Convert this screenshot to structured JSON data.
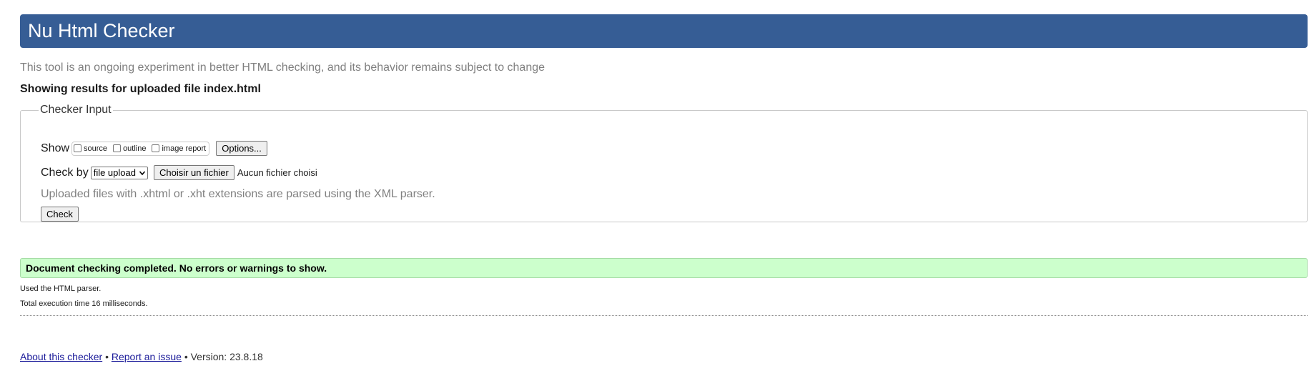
{
  "header": {
    "title": "Nu Html Checker",
    "background_color": "#365d95"
  },
  "tagline": "This tool is an ongoing experiment in better HTML checking, and its behavior remains subject to change",
  "results_for": "Showing results for uploaded file index.html",
  "checker_input": {
    "legend": "Checker Input",
    "show_label": "Show",
    "show_options": [
      {
        "label": "source",
        "checked": false
      },
      {
        "label": "outline",
        "checked": false
      },
      {
        "label": "image report",
        "checked": false
      }
    ],
    "options_button": "Options...",
    "check_by_label": "Check by",
    "check_by_selected": "file upload",
    "choose_file_button": "Choisir un fichier",
    "no_file_text": "Aucun fichier choisi",
    "parser_note": "Uploaded files with .xhtml or .xht extensions are parsed using the XML parser.",
    "check_button": "Check"
  },
  "result": {
    "message": "Document checking completed. No errors or warnings to show.",
    "background_color": "#ccffcc",
    "parser_used": "Used the HTML parser.",
    "execution_time": "Total execution time 16 milliseconds."
  },
  "footer": {
    "about_link": "About this checker",
    "separator": "•",
    "report_link": "Report an issue",
    "version": "Version: 23.8.18"
  }
}
